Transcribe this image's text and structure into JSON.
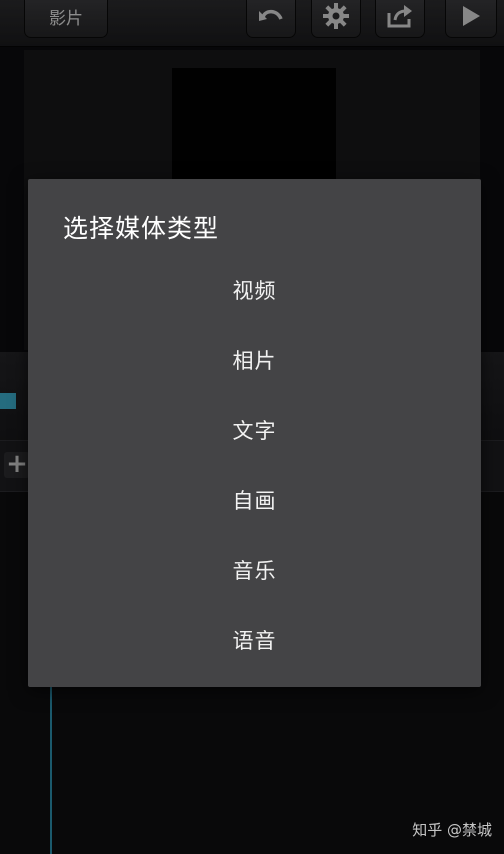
{
  "toolbar": {
    "movie_label": "影片"
  },
  "dialog": {
    "title": "选择媒体类型",
    "options": [
      {
        "label": "视频"
      },
      {
        "label": "相片"
      },
      {
        "label": "文字"
      },
      {
        "label": "自画"
      },
      {
        "label": "音乐"
      },
      {
        "label": "语音"
      }
    ]
  },
  "watermark": {
    "text": "知乎 @禁城"
  },
  "colors": {
    "dialog_bg": "#444446",
    "accent": "#3aa6c4"
  },
  "icons": [
    "undo-icon",
    "settings-gear-icon",
    "share-icon",
    "play-icon",
    "add-icon"
  ]
}
